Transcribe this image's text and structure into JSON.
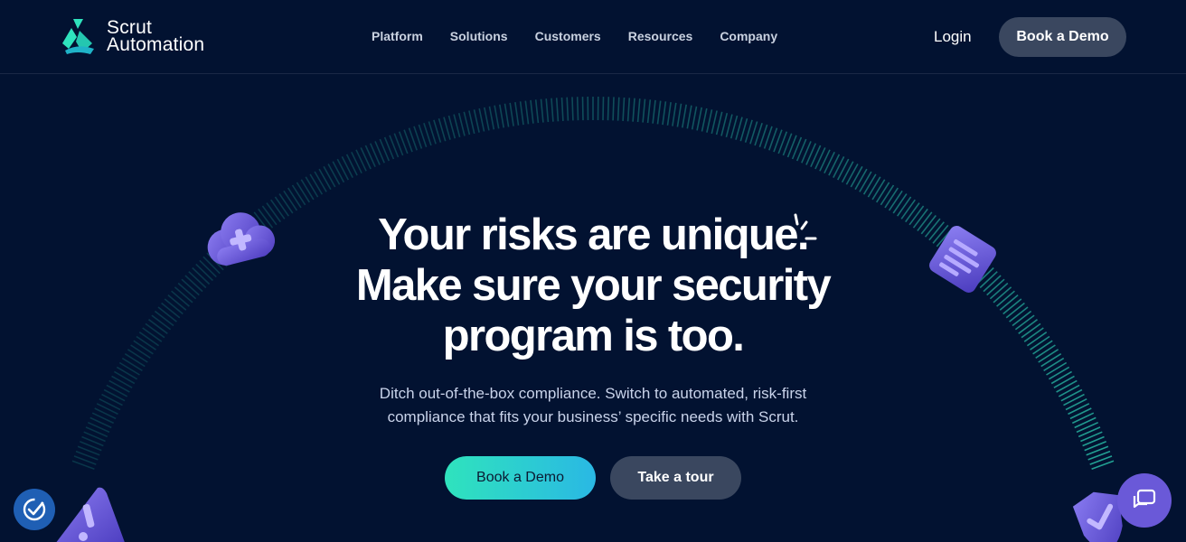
{
  "brand": {
    "line1": "Scrut",
    "line2": "Automation",
    "accent_color": "#2fe3bd"
  },
  "nav": {
    "items": [
      {
        "label": "Platform"
      },
      {
        "label": "Solutions"
      },
      {
        "label": "Customers"
      },
      {
        "label": "Resources"
      },
      {
        "label": "Company"
      }
    ],
    "login": "Login",
    "demo_button": "Book a Demo"
  },
  "hero": {
    "title_line1": "Your risks are unique.",
    "title_line2": "Make sure your security",
    "title_line3": "program is too.",
    "subtitle_line1": "Ditch out-of-the-box compliance. Switch to automated, risk-first",
    "subtitle_line2": "compliance that fits your business’ specific needs with Scrut.",
    "primary_cta": "Book a Demo",
    "secondary_cta": "Take a tour"
  },
  "icons": {
    "cloud": "cloud-plus-icon",
    "document": "document-icon",
    "warning": "warning-triangle-icon",
    "shield": "shield-check-icon",
    "accessibility": "accessibility-check-icon",
    "chat": "chat-icon"
  },
  "colors": {
    "background": "#021231",
    "button_dark": "#3a475f",
    "gradient_start": "#2fe3bd",
    "gradient_end": "#2ab8e4",
    "purple": "#6a59d8"
  }
}
